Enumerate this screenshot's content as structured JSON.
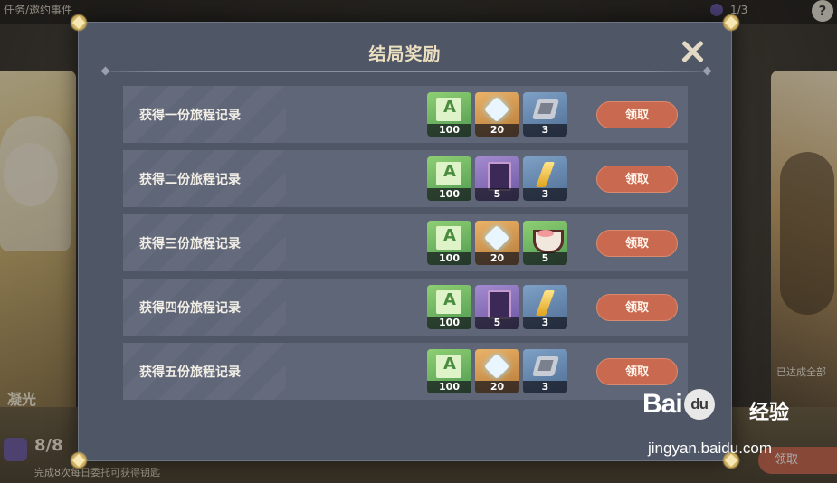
{
  "background": {
    "breadcrumb": "任务/邀约事件",
    "progress": "1/3",
    "help_glyph": "?",
    "character_name": "凝光",
    "keys_count": "8/8",
    "keys_hint": "完成8次每日委托可获得钥匙",
    "right_card_status": "已达成全部",
    "claim_label": "领取"
  },
  "modal": {
    "title": "结局奖励",
    "close_glyph": "✕",
    "rows": [
      {
        "label": "获得一份旅程记录",
        "rewards": [
          {
            "icon": "adventure-exp-icon",
            "qty": "100"
          },
          {
            "icon": "primogem-icon",
            "qty": "20"
          },
          {
            "icon": "enhancement-ore-icon",
            "qty": "3"
          }
        ],
        "claim": "领取"
      },
      {
        "label": "获得二份旅程记录",
        "rewards": [
          {
            "icon": "adventure-exp-icon",
            "qty": "100"
          },
          {
            "icon": "talent-book-icon",
            "qty": "5"
          },
          {
            "icon": "gem-shard-icon",
            "qty": "3"
          }
        ],
        "claim": "领取"
      },
      {
        "label": "获得三份旅程记录",
        "rewards": [
          {
            "icon": "adventure-exp-icon",
            "qty": "100"
          },
          {
            "icon": "primogem-icon",
            "qty": "20"
          },
          {
            "icon": "food-bowl-icon",
            "qty": "5"
          }
        ],
        "claim": "领取"
      },
      {
        "label": "获得四份旅程记录",
        "rewards": [
          {
            "icon": "adventure-exp-icon",
            "qty": "100"
          },
          {
            "icon": "talent-book-icon",
            "qty": "5"
          },
          {
            "icon": "gem-shard-icon",
            "qty": "3"
          }
        ],
        "claim": "领取"
      },
      {
        "label": "获得五份旅程记录",
        "rewards": [
          {
            "icon": "adventure-exp-icon",
            "qty": "100"
          },
          {
            "icon": "primogem-icon",
            "qty": "20"
          },
          {
            "icon": "enhancement-ore-icon",
            "qty": "3"
          }
        ],
        "claim": "领取"
      }
    ]
  },
  "watermark": {
    "logo_left": "Bai",
    "logo_mid": "du",
    "logo_cn": "经验",
    "url": "jingyan.baidu.com"
  }
}
